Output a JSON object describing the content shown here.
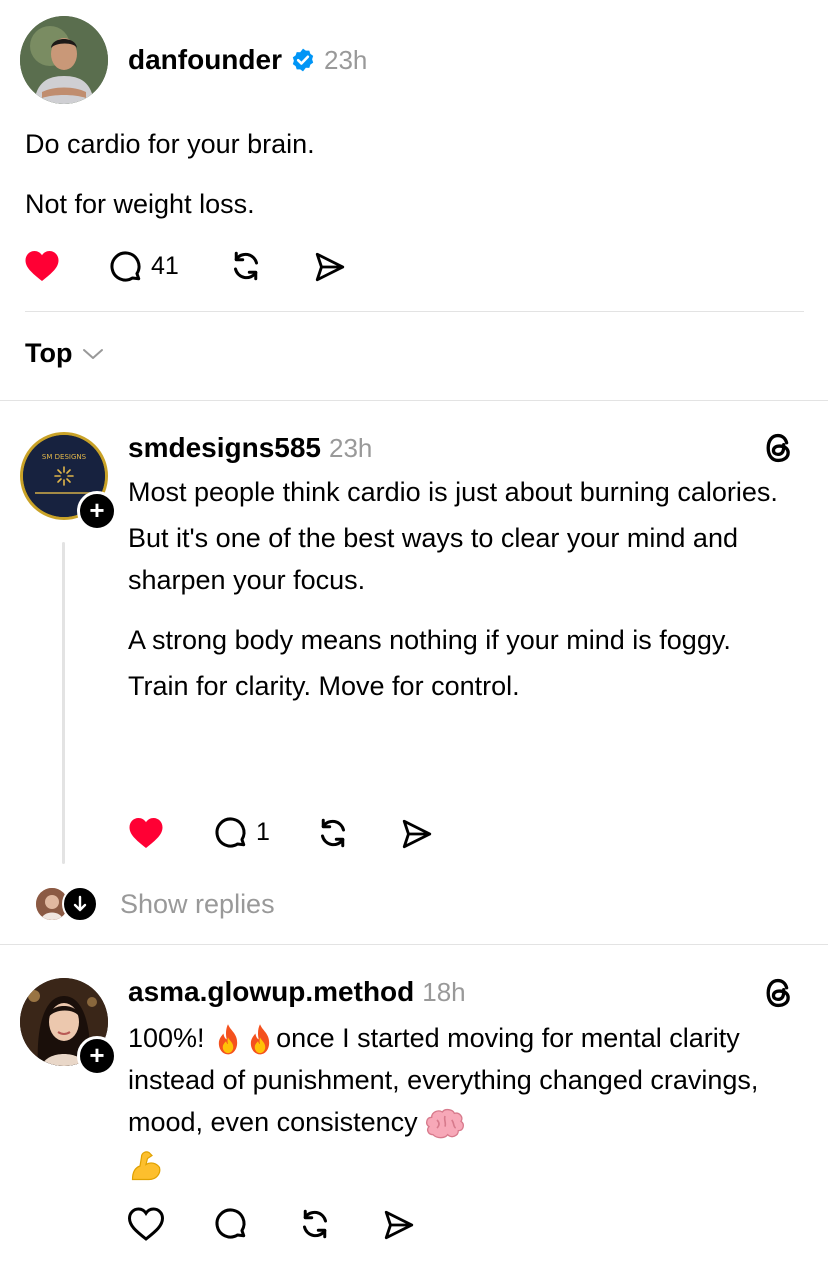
{
  "post": {
    "username": "danfounder",
    "verified": true,
    "time": "23h",
    "lines": [
      "Do cardio for your brain.",
      "Not for weight loss."
    ],
    "liked": true,
    "reply_count": "41"
  },
  "sort": {
    "label": "Top"
  },
  "replies": [
    {
      "username": "smdesigns585",
      "time": "23h",
      "avatar_text": "SM DESIGNS",
      "paragraphs": [
        "Most people think cardio is just about burning calories.",
        "But it's one of the best ways to clear your mind and sharpen your focus.",
        "A strong body means nothing if your mind is foggy.",
        "Train for clarity. Move for control."
      ],
      "liked": true,
      "reply_count": "1",
      "show_replies": "Show replies"
    },
    {
      "username": "asma.glowup.method",
      "time": "18h",
      "text_part1": "100%! ",
      "text_part2": "once I started moving for mental clarity instead of punishment, everything changed  cravings, mood, even consistency ",
      "liked": false
    }
  ],
  "icons": {
    "heart": "heart-icon",
    "comment": "comment-icon",
    "repost": "repost-icon",
    "share": "share-icon",
    "threads": "threads-icon",
    "verified": "verified-badge-icon",
    "chevron": "chevron-down-icon",
    "fire": "fire-emoji",
    "brain": "brain-emoji",
    "muscle": "flexed-biceps-emoji"
  },
  "colors": {
    "like": "#ff0034",
    "verified": "#0095f6",
    "muted": "#999999"
  }
}
